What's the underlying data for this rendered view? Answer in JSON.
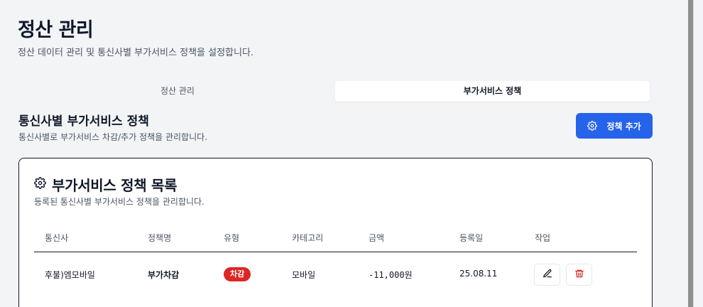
{
  "header": {
    "title": "정산 관리",
    "subtitle": "정산 데이터 관리 및 통신사별 부가서비스 정책을 설정합니다."
  },
  "tabs": [
    {
      "label": "정산 관리",
      "active": false
    },
    {
      "label": "부가서비스 정책",
      "active": true
    }
  ],
  "section": {
    "title": "통신사별 부가서비스 정책",
    "subtitle": "통신사별로 부가서비스 차감/추가 정책을 관리합니다.",
    "add_button_label": "정책 추가",
    "add_button_icon": "gear-icon",
    "accent_color": "#2563eb"
  },
  "card": {
    "title": "부가서비스 정책 목록",
    "title_icon": "gear-icon",
    "subtitle": "등록된 통신사별 부가서비스 정책을 관리합니다."
  },
  "table": {
    "columns": [
      "통신사",
      "정책명",
      "유형",
      "카테고리",
      "금액",
      "등록일",
      "작업"
    ],
    "rows": [
      {
        "carrier": "후불)엠모바일",
        "policy_name": "부가차감",
        "type": "차감",
        "type_color": "#dc2626",
        "category": "모바일",
        "amount": "-11,000원",
        "date": "25.08.11",
        "actions": [
          "edit-icon",
          "trash-icon"
        ]
      }
    ]
  }
}
